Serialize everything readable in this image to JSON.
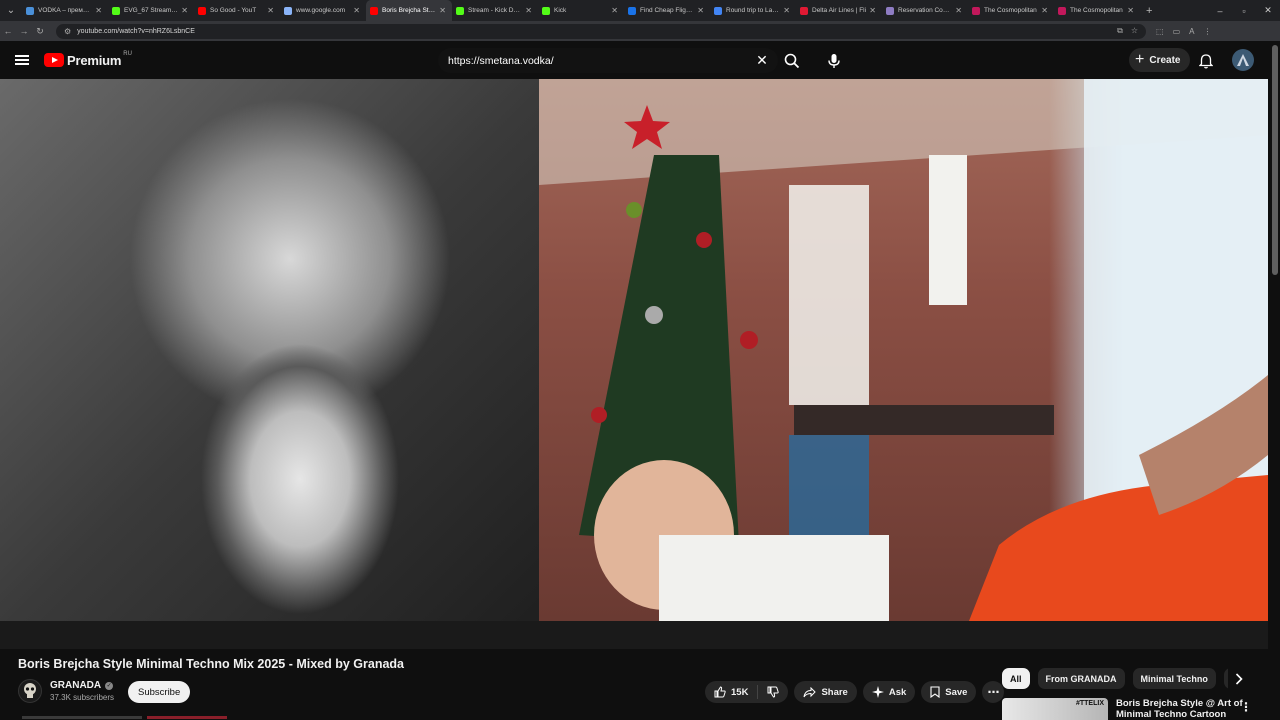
{
  "browser": {
    "tabs": [
      {
        "title": "VODKA – премьер",
        "color": "#4a90d9"
      },
      {
        "title": "EVG_67 Stream - V",
        "color": "#53fc18"
      },
      {
        "title": "So Good - YouT",
        "color": "#ff0000"
      },
      {
        "title": "www.google.com",
        "color": "#8ab4f8"
      },
      {
        "title": "Boris Brejcha Style",
        "color": "#ff0000",
        "active": true
      },
      {
        "title": "Stream - Kick Dash",
        "color": "#53fc18"
      },
      {
        "title": "Kick",
        "color": "#53fc18"
      },
      {
        "title": "Find Cheap Flights",
        "color": "#1a73e8"
      },
      {
        "title": "Round trip to Las V",
        "color": "#4285f4"
      },
      {
        "title": "Delta Air Lines | Fli",
        "color": "#e01933"
      },
      {
        "title": "Reservation Confirm",
        "color": "#8e7cc3"
      },
      {
        "title": "The Cosmopolitan",
        "color": "#c2185b"
      },
      {
        "title": "The Cosmopolitan",
        "color": "#c2185b"
      }
    ],
    "url": "youtube.com/watch?v=nhRZ6LsbnCE"
  },
  "masthead": {
    "logo_text": "Premium",
    "region": "RU",
    "search_value": "https://smetana.vodka/",
    "create_label": "Create"
  },
  "video": {
    "title": "Boris Brejcha Style Minimal Techno Mix 2025 - Mixed by Granada",
    "channel": "GRANADA",
    "subscribers": "37.3K subscribers",
    "subscribe_label": "Subscribe",
    "likes": "15K",
    "share_label": "Share",
    "ask_label": "Ask",
    "save_label": "Save"
  },
  "chips": [
    "All",
    "From GRANADA",
    "Minimal Techno",
    "Ele"
  ],
  "recommendation": {
    "thumb_text": "#TTELIX",
    "title": "Boris Brejcha Style @ Art of Minimal Techno Cartoon"
  }
}
